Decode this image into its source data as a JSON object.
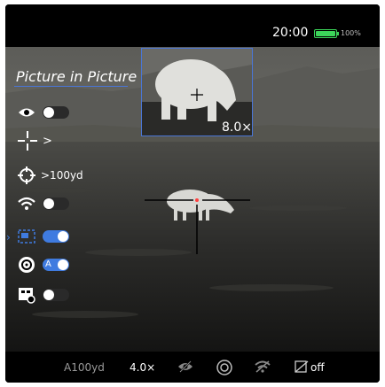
{
  "status": {
    "time": "20:00",
    "battery_percent": "100%",
    "battery_level": 1.0
  },
  "menu": {
    "title": "Picture in Picture",
    "items": [
      {
        "icon": "eye-icon",
        "control": "toggle",
        "state": "off"
      },
      {
        "icon": "crosshair-icon",
        "control": "chevron",
        "label": ">"
      },
      {
        "icon": "target-icon",
        "control": "value",
        "label": ">100yd"
      },
      {
        "icon": "wifi-icon",
        "control": "toggle",
        "state": "off"
      },
      {
        "icon": "pip-icon",
        "control": "toggle",
        "state": "on",
        "selected": true
      },
      {
        "icon": "auto-calibration-icon",
        "control": "toggle",
        "state": "on",
        "toggle_letter": "A"
      },
      {
        "icon": "video-record-icon",
        "control": "toggle",
        "state": "off"
      }
    ]
  },
  "pip": {
    "zoom": "8.0×"
  },
  "bottom_bar": {
    "distance": "A100yd",
    "zoom": "4.0×",
    "icons": [
      "eye-off-icon",
      "calibration-status-icon",
      "wifi-off-icon",
      "rangefinder-icon"
    ],
    "rangefinder_state": "off"
  },
  "colors": {
    "accent": "#3f7be0",
    "battery": "#3cd65a",
    "reticle_dot": "#ff4040"
  }
}
